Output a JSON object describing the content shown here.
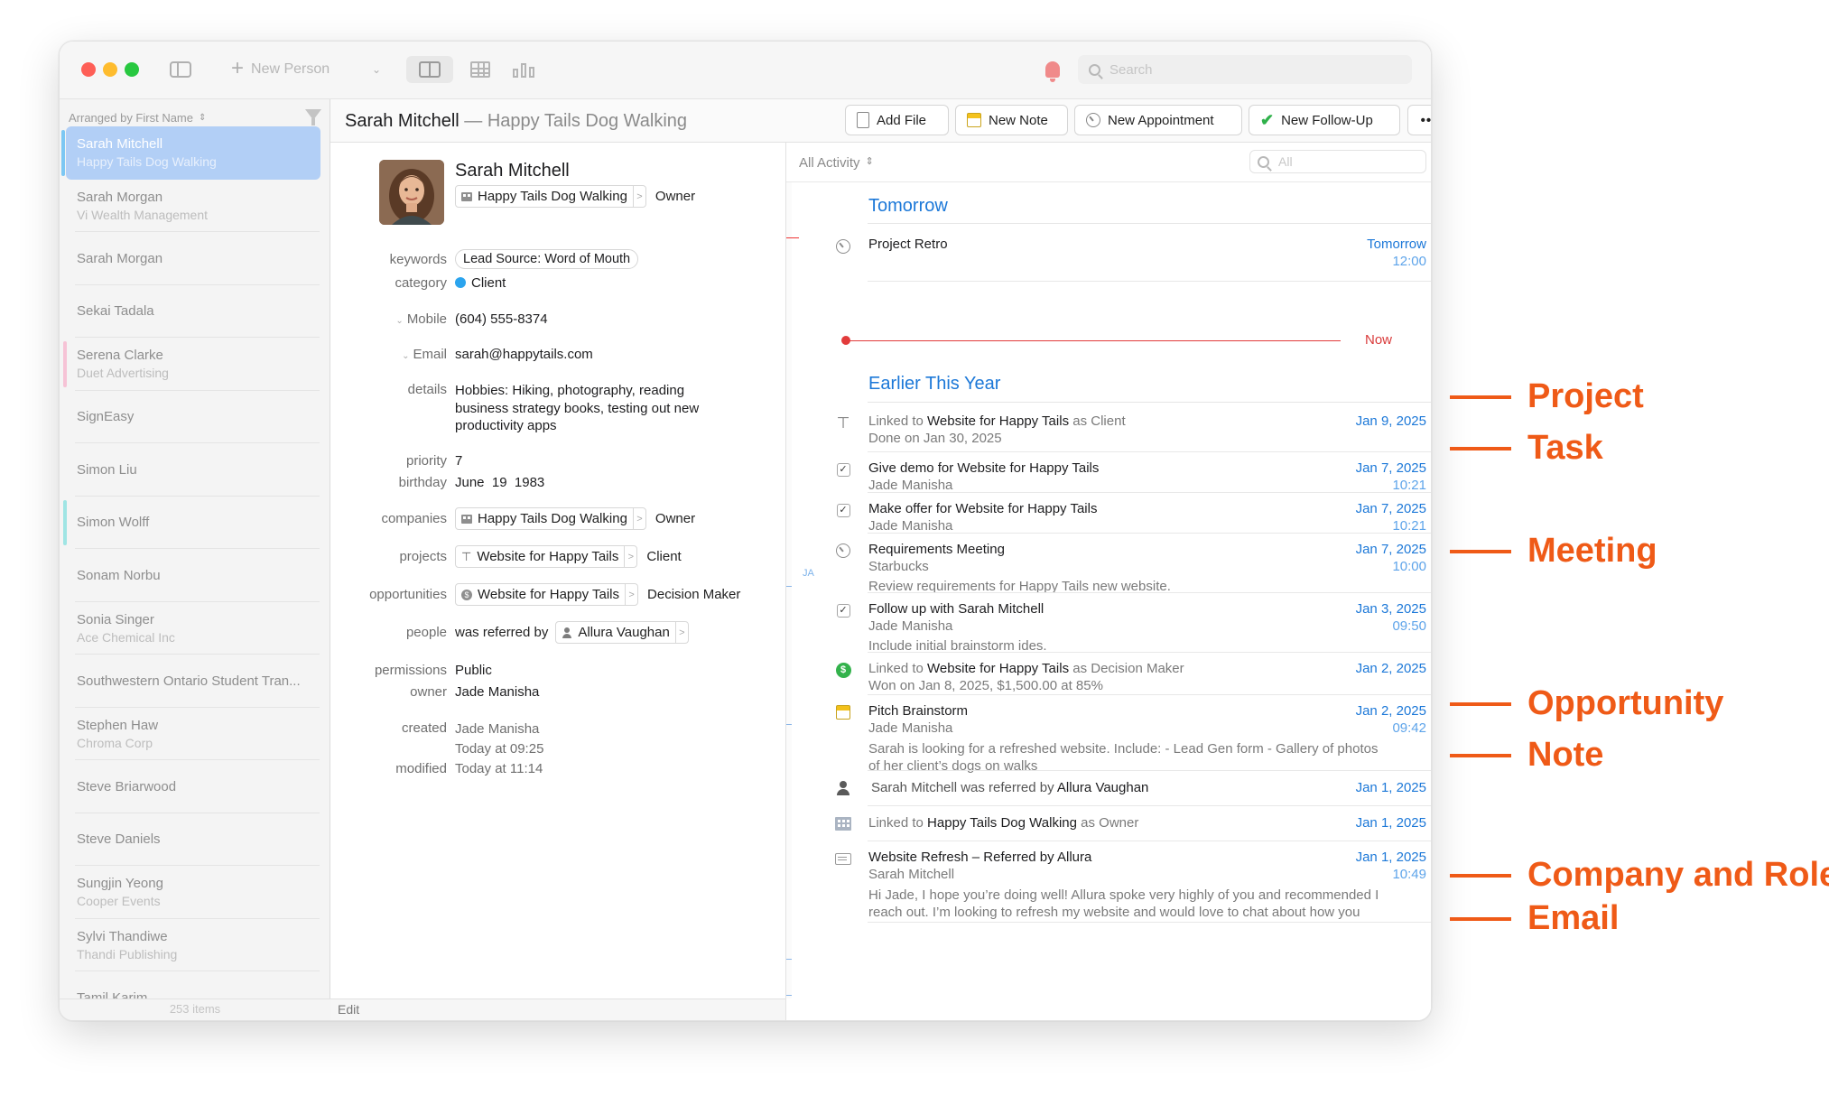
{
  "toolbar": {
    "new_person_label": "New Person",
    "search_placeholder": "Search"
  },
  "sidebar": {
    "sort_label": "Arranged by First Name",
    "sort_chevron": "⌃",
    "footer": "253 items",
    "people": [
      {
        "name": "Sarah Mitchell",
        "org": "Happy Tails Dog Walking",
        "selected": true,
        "tag": "#7cc7f3"
      },
      {
        "name": "Sarah Morgan",
        "org": "Vi Wealth Management"
      },
      {
        "name": "Sarah Morgan",
        "org": ""
      },
      {
        "name": "Sekai Tadala",
        "org": ""
      },
      {
        "name": "Serena Clarke",
        "org": "Duet Advertising",
        "tag": "#f6c3d6"
      },
      {
        "name": "SignEasy",
        "org": ""
      },
      {
        "name": "Simon Liu",
        "org": ""
      },
      {
        "name": "Simon Wolff",
        "org": "",
        "tag": "#9fe5e4"
      },
      {
        "name": "Sonam Norbu",
        "org": ""
      },
      {
        "name": "Sonia Singer",
        "org": "Ace Chemical Inc"
      },
      {
        "name": "Southwestern Ontario Student Tran...",
        "org": ""
      },
      {
        "name": "Stephen Haw",
        "org": "Chroma Corp"
      },
      {
        "name": "Steve Briarwood",
        "org": ""
      },
      {
        "name": "Steve Daniels",
        "org": ""
      },
      {
        "name": "Sungjin Yeong",
        "org": "Cooper Events"
      },
      {
        "name": "Sylvi Thandiwe",
        "org": "Thandi Publishing"
      },
      {
        "name": "Tamil Karim",
        "org": ""
      }
    ]
  },
  "header": {
    "name": "Sarah Mitchell",
    "separator": " — ",
    "company": "Happy Tails Dog Walking",
    "buttons": {
      "add_file": "Add File",
      "new_note": "New Note",
      "new_appointment": "New Appointment",
      "new_follow_up": "New Follow-Up",
      "more": "•••"
    }
  },
  "details": {
    "name": "Sarah Mitchell",
    "company": "Happy Tails Dog Walking",
    "role": "Owner",
    "fields": {
      "keywords_label": "keywords",
      "keywords": "Lead Source: Word of Mouth",
      "category_label": "category",
      "category": "Client",
      "category_color": "#2ba4ee",
      "mobile_label": "Mobile",
      "mobile": "(604) 555-8374",
      "email_label": "Email",
      "email": "sarah@happytails.com",
      "details_label": "details",
      "details_line1": "Hobbies: Hiking, photography, reading",
      "details_line2": "business strategy books, testing out new",
      "details_line3": "productivity apps",
      "priority_label": "priority",
      "priority": "7",
      "birthday_label": "birthday",
      "birthday": "June  19  1983",
      "companies_label": "companies",
      "companies_value": "Happy Tails Dog Walking",
      "companies_role": "Owner",
      "projects_label": "projects",
      "projects_value": "Website for Happy Tails",
      "projects_role": "Client",
      "opportunities_label": "opportunities",
      "opportunities_value": "Website for Happy Tails",
      "opportunities_role": "Decision Maker",
      "people_label": "people",
      "people_relation": "was referred by",
      "people_value": "Allura Vaughan",
      "permissions_label": "permissions",
      "permissions": "Public",
      "owner_label": "owner",
      "owner": "Jade Manisha",
      "created_label": "created",
      "created_by": "Jade Manisha",
      "created_at": "Today at 09:25",
      "modified_label": "modified",
      "modified_at": "Today at 11:14"
    },
    "footer": "Edit"
  },
  "activity": {
    "filter": "All Activity",
    "search_placeholder": "All",
    "month_marker": "JA",
    "sections": {
      "tomorrow": "Tomorrow",
      "earlier": "Earlier This Year"
    },
    "now_label": "Now",
    "items": [
      {
        "kind": "meeting",
        "title": "Project Retro",
        "date": "Tomorrow",
        "time": "12:00",
        "bar": "#f0a21c"
      },
      {
        "kind": "project",
        "pre": "Linked to ",
        "title": "Website for Happy Tails",
        "post": " as Client",
        "sub": "Done on Jan 30, 2025",
        "date": "Jan 9, 2025",
        "bar": "#f0b81c"
      },
      {
        "kind": "task",
        "title": "Give demo for Website for Happy Tails",
        "sub": "Jade Manisha",
        "date": "Jan 7, 2025",
        "time": "10:21"
      },
      {
        "kind": "task",
        "title": "Make offer for Website for Happy Tails",
        "sub": "Jade Manisha",
        "date": "Jan 7, 2025",
        "time": "10:21"
      },
      {
        "kind": "meeting",
        "title": "Requirements Meeting",
        "sub": "Starbucks",
        "note": "Review requirements for Happy Tails new website.",
        "date": "Jan 7, 2025",
        "time": "10:00",
        "bar": "#86e3dd"
      },
      {
        "kind": "task",
        "title": "Follow up with Sarah Mitchell",
        "sub": "Jade Manisha",
        "note": "Include initial brainstorm ides.",
        "date": "Jan 3, 2025",
        "time": "09:50",
        "bar": "#dd7ef0"
      },
      {
        "kind": "opportunity",
        "pre": "Linked to ",
        "title": "Website for Happy Tails",
        "post": " as Decision Maker",
        "sub": "Won on Jan 8, 2025, $1,500.00 at 85%",
        "date": "Jan 2, 2025"
      },
      {
        "kind": "note",
        "title": "Pitch Brainstorm",
        "sub": "Jade Manisha",
        "note1": "Sarah is looking for a refreshed website. Include: - Lead Gen form - Gallery of photos",
        "note2": "of her client’s dogs on walks",
        "date": "Jan 2, 2025",
        "time": "09:42",
        "bar": "#8f5a3c"
      },
      {
        "kind": "person",
        "pre": "Sarah Mitchell was referred by ",
        "title": "Allura Vaughan",
        "date": "Jan 1, 2025",
        "bar": "#f0a21c"
      },
      {
        "kind": "company",
        "pre": "Linked to ",
        "title": "Happy Tails Dog Walking",
        "post": " as Owner",
        "date": "Jan 1, 2025",
        "bar": "#f04fe0"
      },
      {
        "kind": "email",
        "title": "Website Refresh – Referred by Allura",
        "sub": "Sarah Mitchell",
        "note1": "Hi Jade, I hope you’re doing well! Allura spoke very highly of you and recommended I",
        "note2": "reach out. I’m looking to refresh my website and would love to chat about how you",
        "date": "Jan 1, 2025",
        "time": "10:49"
      }
    ]
  },
  "callouts": [
    "Project",
    "Task",
    "Meeting",
    "Opportunity",
    "Note",
    "Company and Role",
    "Email"
  ],
  "colors": {
    "accent": "#1c78d8",
    "callout": "#ef5a17",
    "selection": "#b2cff6"
  }
}
